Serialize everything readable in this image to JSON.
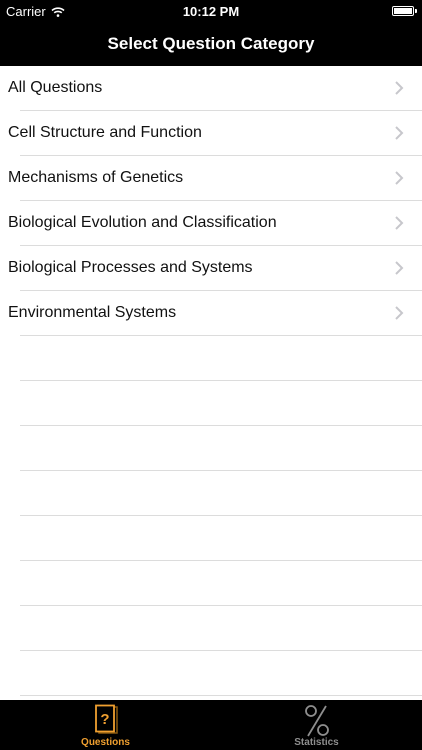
{
  "status_bar": {
    "carrier": "Carrier",
    "time": "10:12 PM"
  },
  "nav_bar": {
    "title": "Select Question Category"
  },
  "categories": [
    {
      "label": "All Questions"
    },
    {
      "label": "Cell Structure and Function"
    },
    {
      "label": "Mechanisms of Genetics"
    },
    {
      "label": "Biological Evolution and Classification"
    },
    {
      "label": "Biological Processes and Systems"
    },
    {
      "label": "Environmental Systems"
    }
  ],
  "tab_bar": {
    "tabs": [
      {
        "label": "Questions",
        "icon": "question-card-icon",
        "active": true
      },
      {
        "label": "Statistics",
        "icon": "percent-icon",
        "active": false
      }
    ]
  },
  "colors": {
    "bar_background": "#000000",
    "active_tab": "#f0a030",
    "inactive_tab": "#8e8e8e",
    "separator": "#dcdcdc",
    "chevron": "#c7c7cc"
  }
}
